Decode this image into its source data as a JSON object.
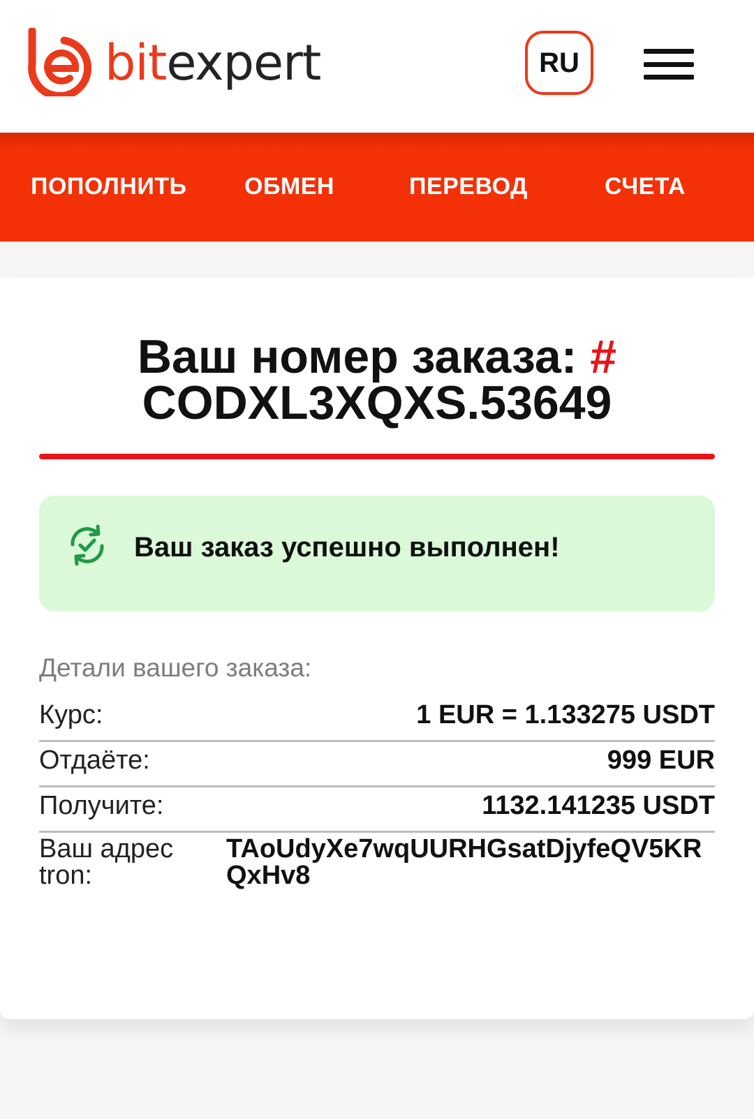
{
  "header": {
    "logo_bit": "bit",
    "logo_expert": "expert",
    "logo_icon": "bitexpert-logo-icon",
    "lang_label": "RU",
    "menu_icon": "hamburger-menu-icon"
  },
  "nav": {
    "items": [
      {
        "label": "ПОПОЛНИТЬ"
      },
      {
        "label": "ОБМЕН"
      },
      {
        "label": "ПЕРЕВОД"
      },
      {
        "label": "СЧЕТА"
      }
    ]
  },
  "order": {
    "title_prefix": "Ваш номер заказа: ",
    "hash": "#",
    "number": "CODXL3XQXS.53649"
  },
  "status": {
    "icon": "refresh-check-icon",
    "message": "Ваш заказ успешно выполнен!"
  },
  "details": {
    "heading": "Детали вашего заказа:",
    "rows": [
      {
        "label": "Курс:",
        "value": "1 EUR = 1.133275 USDT"
      },
      {
        "label": "Отдаёте:",
        "value": "999 EUR"
      },
      {
        "label": "Получите:",
        "value": "1132.141235 USDT"
      },
      {
        "label": "Ваш адрес tron:",
        "value": "TAoUdyXe7wqUURHGsatDjyfeQV5KRQxHv8"
      }
    ]
  },
  "colors": {
    "brand": "#ea3a1c",
    "nav_bg": "#f53006",
    "accent_red": "#e8141b",
    "success_bg": "#dbf8d9",
    "success_icon": "#1f9a46"
  }
}
